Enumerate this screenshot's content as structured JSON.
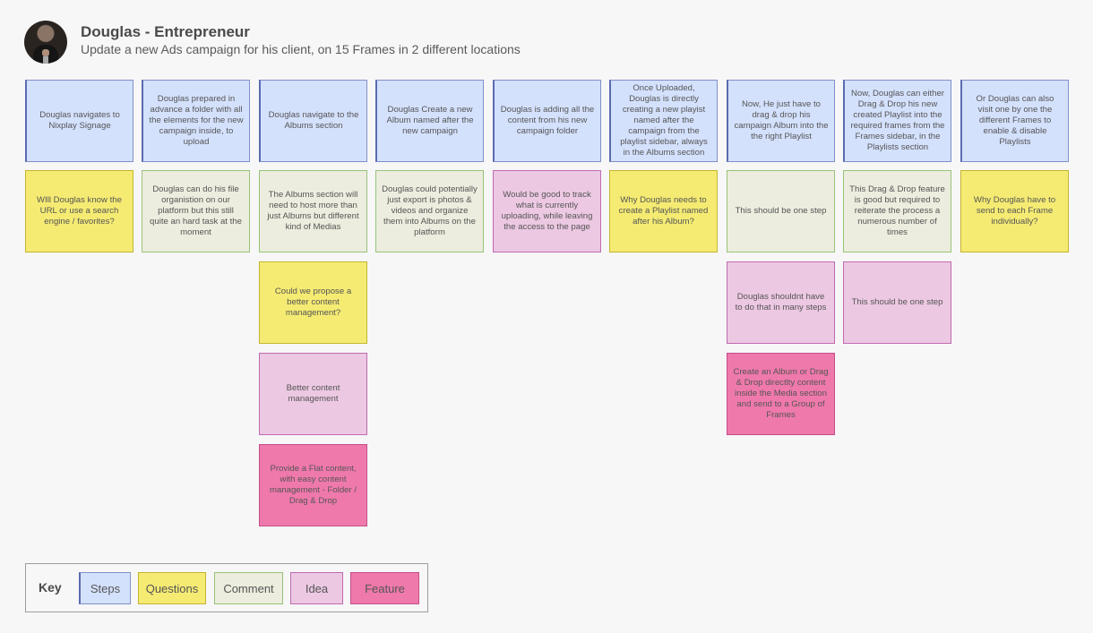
{
  "header": {
    "title": "Douglas - Entrepreneur",
    "subtitle": "Update a new Ads campaign for his client, on 15 Frames in 2 different locations"
  },
  "colors": {
    "steps": "#d4e1fd",
    "question": "#f5eb73",
    "comment": "#ecedde",
    "idea": "#ecc8e2",
    "feature": "#ef79ab",
    "background": "#f7f7f7"
  },
  "columns": [
    {
      "notes": [
        {
          "type": "steps",
          "text": "Douglas navigates to Nixplay Signage"
        },
        {
          "type": "question",
          "text": "WIll Douglas know the URL or use a search engine / favorites?"
        }
      ]
    },
    {
      "notes": [
        {
          "type": "steps",
          "text": "Douglas prepared in advance a folder with all the elements for the new campaign inside, to upload"
        },
        {
          "type": "comment",
          "text": "Douglas can do his file organistion on our platform but this still quite an hard task at the moment"
        }
      ]
    },
    {
      "notes": [
        {
          "type": "steps",
          "text": "Douglas navigate to the Albums section"
        },
        {
          "type": "comment",
          "text": "The Albums section will need to host more than just Albums but different kind of Medias"
        },
        {
          "type": "question",
          "text": "Could we propose a better content management?"
        },
        {
          "type": "idea",
          "text": "Better content management"
        },
        {
          "type": "feature",
          "text": "Provide a Flat content, with easy content management - Folder / Drag & Drop"
        }
      ]
    },
    {
      "notes": [
        {
          "type": "steps",
          "text": "Douglas Create a new Album named after the new campaign"
        },
        {
          "type": "comment",
          "text": "Douglas could potentially just export is photos & videos and organize them into Albums on the platform"
        }
      ]
    },
    {
      "notes": [
        {
          "type": "steps",
          "text": "Douglas is adding all the content from his new campaign folder"
        },
        {
          "type": "idea",
          "text": "Would be good to track what is currently uploading, while leaving the access to the page"
        }
      ]
    },
    {
      "notes": [
        {
          "type": "steps",
          "text": "Once Uploaded, Douglas is directly creating a new playist named after the campaign from the playlist sidebar, always in the Albums section"
        },
        {
          "type": "question",
          "text": "Why Douglas needs to create a Playlist named after his Album?"
        }
      ]
    },
    {
      "notes": [
        {
          "type": "steps",
          "text": "Now, He just have to drag & drop his campaign Album into the the right Playlist"
        },
        {
          "type": "comment",
          "text": "This should be one step"
        },
        {
          "type": "idea",
          "text": "Douglas shouldnt have to do that in many steps"
        },
        {
          "type": "feature",
          "text": "Create an Album or Drag & Drop directlty content inside  the Media section and send to a Group of Frames"
        }
      ]
    },
    {
      "notes": [
        {
          "type": "steps",
          "text": "Now, Douglas can either Drag & Drop his new created Playlist into the required frames from the Frames sidebar, in the Playlists section"
        },
        {
          "type": "comment",
          "text": "This Drag & Drop feature is good but required to reiterate the process a numerous number of times"
        },
        {
          "type": "idea",
          "text": "This should be one step"
        }
      ]
    },
    {
      "notes": [
        {
          "type": "steps",
          "text": "Or Douglas can also visit one by one the different Frames to enable & disable Playlists"
        },
        {
          "type": "question",
          "text": "Why Douglas have to send to each Frame individually?"
        }
      ]
    }
  ],
  "key": {
    "label": "Key",
    "items": [
      {
        "type": "steps",
        "label": "Steps"
      },
      {
        "type": "question",
        "label": "Questions"
      },
      {
        "type": "comment",
        "label": "Comment"
      },
      {
        "type": "idea",
        "label": "Idea"
      },
      {
        "type": "feature",
        "label": "Feature"
      }
    ]
  }
}
